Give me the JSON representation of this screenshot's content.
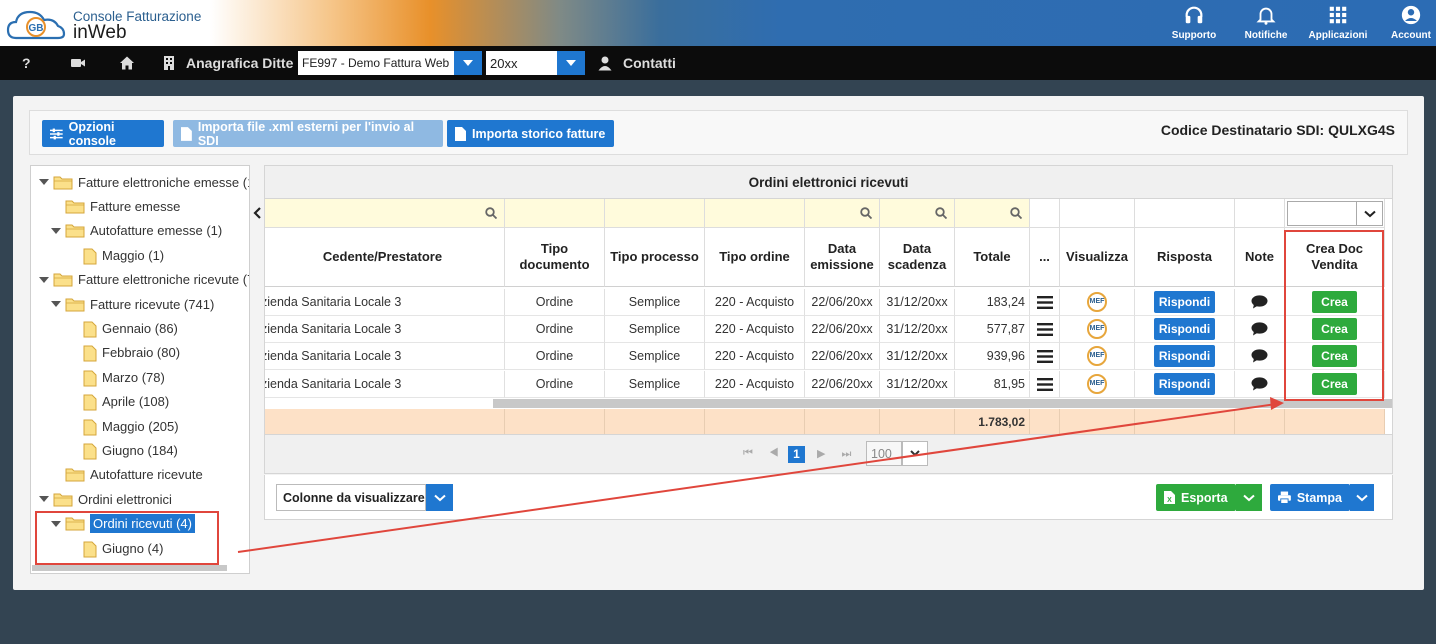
{
  "header": {
    "brand_line1": "Console Fatturazione",
    "brand_line2": "inWeb",
    "logo_text": "GB",
    "nav": [
      {
        "label": "Supporto",
        "icon": "headset-icon"
      },
      {
        "label": "Notifiche",
        "icon": "bell-icon"
      },
      {
        "label": "Applicazioni",
        "icon": "grid-icon"
      },
      {
        "label": "Account",
        "icon": "account-icon"
      }
    ]
  },
  "menubar": {
    "help": "?",
    "anagrafica_label": "Anagrafica Ditte",
    "company_select": "FE997 - Demo Fattura Web",
    "year_select": "20xx",
    "contatti_label": "Contatti"
  },
  "toolbar": {
    "opzioni_label": "Opzioni console",
    "importa_xml_label": "Importa file .xml esterni per l'invio al SDI",
    "importa_storico_label": "Importa storico fatture",
    "codice_destinatario": "Codice Destinatario SDI: QULXG4S"
  },
  "tree": {
    "nodes": [
      {
        "label": "Fatture elettroniche emesse (1",
        "level": 0,
        "caret": true
      },
      {
        "label": "Fatture emesse",
        "level": 1,
        "caret": false
      },
      {
        "label": "Autofatture emesse (1)",
        "level": 1,
        "caret": true
      },
      {
        "label": "Maggio (1)",
        "level": 2,
        "caret": false
      },
      {
        "label": "Fatture elettroniche ricevute (7",
        "level": 0,
        "caret": true
      },
      {
        "label": "Fatture ricevute (741)",
        "level": 1,
        "caret": true
      },
      {
        "label": "Gennaio (86)",
        "level": 2,
        "caret": false
      },
      {
        "label": "Febbraio (80)",
        "level": 2,
        "caret": false
      },
      {
        "label": "Marzo (78)",
        "level": 2,
        "caret": false
      },
      {
        "label": "Aprile (108)",
        "level": 2,
        "caret": false
      },
      {
        "label": "Maggio (205)",
        "level": 2,
        "caret": false
      },
      {
        "label": "Giugno (184)",
        "level": 2,
        "caret": false
      },
      {
        "label": "Autofatture ricevute",
        "level": 1,
        "caret": false
      },
      {
        "label": "Ordini elettronici",
        "level": 0,
        "caret": true
      },
      {
        "label": "Ordini ricevuti (4)",
        "level": 1,
        "caret": true,
        "selected": true
      },
      {
        "label": "Giugno (4)",
        "level": 2,
        "caret": false
      }
    ]
  },
  "grid": {
    "title": "Ordini elettronici ricevuti",
    "columns": [
      "Cedente/Prestatore",
      "Tipo documento",
      "Tipo processo",
      "Tipo ordine",
      "Data emissione",
      "Data scadenza",
      "Totale",
      "...",
      "Visualizza",
      "Risposta",
      "Note",
      "Crea Doc Vendita"
    ],
    "rows": [
      {
        "cedente": "zienda Sanitaria Locale 3",
        "tipo_doc": "Ordine",
        "processo": "Semplice",
        "ordine": "220 - Acquisto",
        "emissione": "22/06/20xx",
        "scadenza": "31/12/20xx",
        "totale": "183,24"
      },
      {
        "cedente": "zienda Sanitaria Locale 3",
        "tipo_doc": "Ordine",
        "processo": "Semplice",
        "ordine": "220 - Acquisto",
        "emissione": "22/06/20xx",
        "scadenza": "31/12/20xx",
        "totale": "577,87"
      },
      {
        "cedente": "zienda Sanitaria Locale 3",
        "tipo_doc": "Ordine",
        "processo": "Semplice",
        "ordine": "220 - Acquisto",
        "emissione": "22/06/20xx",
        "scadenza": "31/12/20xx",
        "totale": "939,96"
      },
      {
        "cedente": "zienda Sanitaria Locale 3",
        "tipo_doc": "Ordine",
        "processo": "Semplice",
        "ordine": "220 - Acquisto",
        "emissione": "22/06/20xx",
        "scadenza": "31/12/20xx",
        "totale": "81,95"
      }
    ],
    "visualizza_icon_text": "MEF",
    "rispondi_label": "Rispondi",
    "crea_label": "Crea",
    "grand_total": "1.783,02"
  },
  "pager": {
    "current_page": "1",
    "page_size": "100"
  },
  "footer": {
    "colonne_label": "Colonne da visualizzare",
    "esporta_label": "Esporta",
    "stampa_label": "Stampa"
  },
  "colors": {
    "accent_blue": "#1f77d0",
    "create_green": "#2eaa3d",
    "annotation_red": "#e0463c",
    "total_row": "#fde1c7",
    "filter_row": "#fffbdc"
  }
}
